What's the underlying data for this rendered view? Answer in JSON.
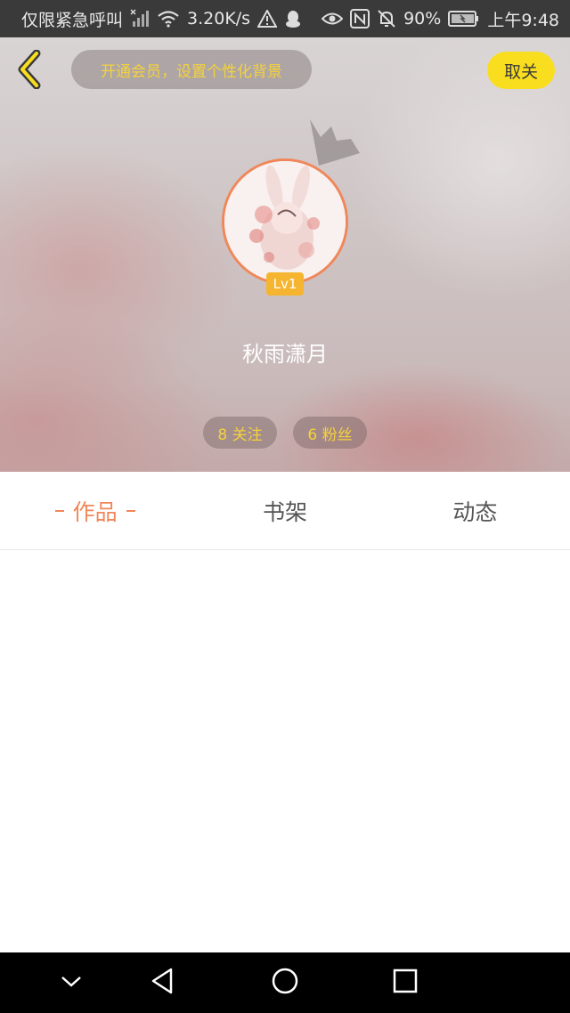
{
  "status_bar": {
    "carrier_text": "仅限紧急呼叫",
    "network_speed": "3.20K/s",
    "battery_percent": "90%",
    "time": "上午9:48",
    "icons": [
      "no-signal-icon",
      "wifi-icon",
      "warning-icon",
      "qq-icon",
      "eye-icon",
      "nfc-icon",
      "mute-bell-icon",
      "battery-icon"
    ]
  },
  "header": {
    "back_icon": "chevron-left-icon",
    "vip_banner": "开通会员，设置个性化背景",
    "cancel_label": "取关",
    "accent_color": "#f9de1f"
  },
  "profile": {
    "level": "Lv1",
    "username": "秋雨潇月",
    "follow_label": "8 关注",
    "fans_label": "6 粉丝"
  },
  "tabs": [
    {
      "label": "作品",
      "active": true
    },
    {
      "label": "书架",
      "active": false
    },
    {
      "label": "动态",
      "active": false
    }
  ],
  "nav_bar": {
    "icons": [
      "collapse-icon",
      "back-triangle-icon",
      "home-circle-icon",
      "recents-square-icon"
    ]
  },
  "colors": {
    "active_tab": "#f0875a",
    "stat_text": "#f5d23b",
    "level_badge": "#f5b530"
  }
}
